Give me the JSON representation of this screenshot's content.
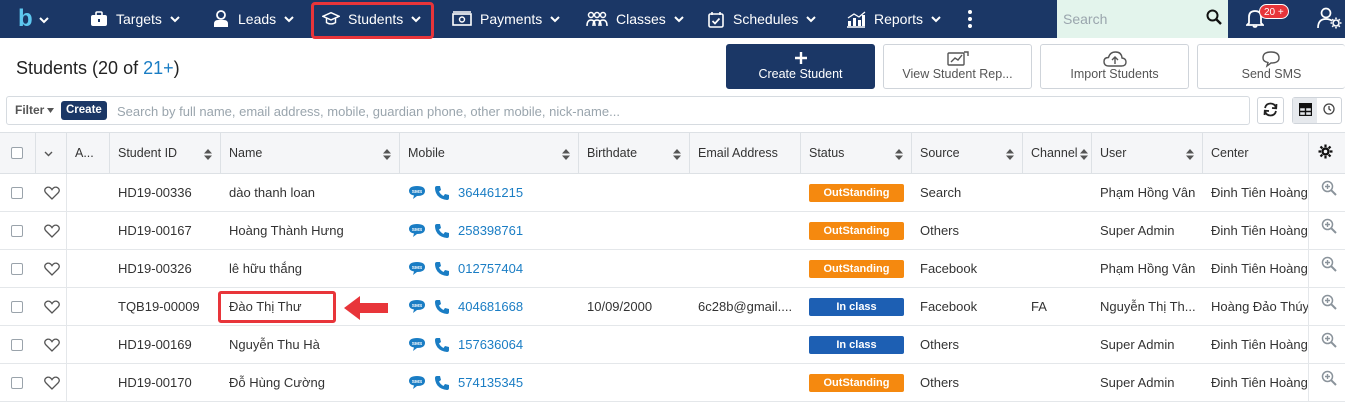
{
  "nav": {
    "brand_letter": "b",
    "items": [
      {
        "label": "Targets",
        "icon": "briefcase-icon"
      },
      {
        "label": "Leads",
        "icon": "user-tie-icon"
      },
      {
        "label": "Students",
        "icon": "graduation-cap-icon"
      },
      {
        "label": "Payments",
        "icon": "money-icon"
      },
      {
        "label": "Classes",
        "icon": "group-icon"
      },
      {
        "label": "Schedules",
        "icon": "calendar-check-icon"
      },
      {
        "label": "Reports",
        "icon": "bar-chart-icon"
      }
    ],
    "search_placeholder": "Search",
    "notification_count": "20 +"
  },
  "page": {
    "title": "Students (20 of ",
    "count_link": "21+",
    "title_end": ")"
  },
  "actions": {
    "create_student": "Create Student",
    "view_report": "View Student Rep...",
    "import_students": "Import Students",
    "send_sms": "Send SMS"
  },
  "filter": {
    "filter_label": "Filter",
    "create_label": "Create",
    "placeholder": "Search by full name, email address, mobile, guardian phone, other mobile, nick-name..."
  },
  "columns": {
    "a": "A...",
    "student_id": "Student ID",
    "name": "Name",
    "mobile": "Mobile",
    "birthdate": "Birthdate",
    "email": "Email Address",
    "status": "Status",
    "source": "Source",
    "channel": "Channel",
    "user": "User",
    "center": "Center"
  },
  "rows": [
    {
      "id": "HD19-00336",
      "name": "dào thanh loan",
      "mobile": "364461215",
      "birthdate": "",
      "email": "",
      "status": "OutStanding",
      "source": "Search",
      "channel": "",
      "user": "Phạm Hồng Vân",
      "center": "Đinh Tiên Hoàng"
    },
    {
      "id": "HD19-00167",
      "name": "Hoàng Thành Hưng",
      "mobile": "258398761",
      "birthdate": "",
      "email": "",
      "status": "OutStanding",
      "source": "Others",
      "channel": "",
      "user": "Super Admin",
      "center": "Đinh Tiên Hoàng"
    },
    {
      "id": "HD19-00326",
      "name": "lê hữu thắng",
      "mobile": "012757404",
      "birthdate": "",
      "email": "",
      "status": "OutStanding",
      "source": "Facebook",
      "channel": "",
      "user": "Phạm Hồng Vân",
      "center": "Đinh Tiên Hoàng"
    },
    {
      "id": "TQB19-00009",
      "name": "Đào Thị Thư",
      "mobile": "404681668",
      "birthdate": "10/09/2000",
      "email": "6c28b@gmail....",
      "status": "In class",
      "source": "Facebook",
      "channel": "FA",
      "user": "Nguyễn Thị Th...",
      "center": "Hoàng Đảo Thúy"
    },
    {
      "id": "HD19-00169",
      "name": "Nguyễn Thu Hà",
      "mobile": "157636064",
      "birthdate": "",
      "email": "",
      "status": "In class",
      "source": "Others",
      "channel": "",
      "user": "Super Admin",
      "center": "Đinh Tiên Hoàng"
    },
    {
      "id": "HD19-00170",
      "name": "Đỗ Hùng Cường",
      "mobile": "574135345",
      "birthdate": "",
      "email": "",
      "status": "OutStanding",
      "source": "Others",
      "channel": "",
      "user": "Super Admin",
      "center": "Đinh Tiên Hoàng"
    }
  ],
  "colors": {
    "nav_bg": "#1b3766",
    "outstanding": "#f5890f",
    "in_class": "#1d5fb3",
    "link": "#1a7dc4",
    "annotation_red": "#e8353a"
  }
}
